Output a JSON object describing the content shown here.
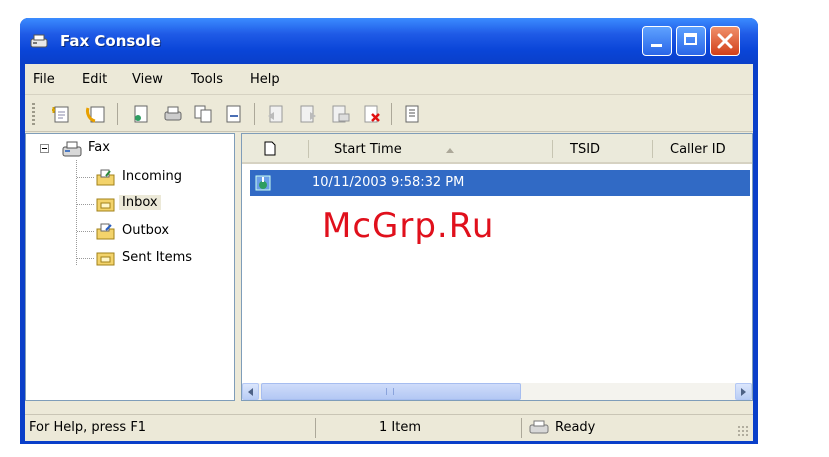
{
  "window": {
    "title": "Fax Console"
  },
  "menu": [
    "File",
    "Edit",
    "View",
    "Tools",
    "Help"
  ],
  "toolbar": {
    "icons": [
      "send-fax-icon",
      "receive-fax-icon",
      "view-icon",
      "print-icon",
      "copy-icon",
      "save-icon",
      "reply-icon",
      "forward-icon",
      "email-icon",
      "delete-icon",
      "properties-icon"
    ]
  },
  "tree": {
    "root": "Fax",
    "items": [
      "Incoming",
      "Inbox",
      "Outbox",
      "Sent Items"
    ],
    "selected": "Inbox"
  },
  "list": {
    "columns": [
      "Start Time",
      "TSID",
      "Caller ID"
    ],
    "rows": [
      {
        "start_time": "10/11/2003 9:58:32 PM"
      }
    ]
  },
  "status": {
    "help": "For Help, press F1",
    "count": "1 Item",
    "state": "Ready"
  },
  "watermark": "McGrp.Ru"
}
